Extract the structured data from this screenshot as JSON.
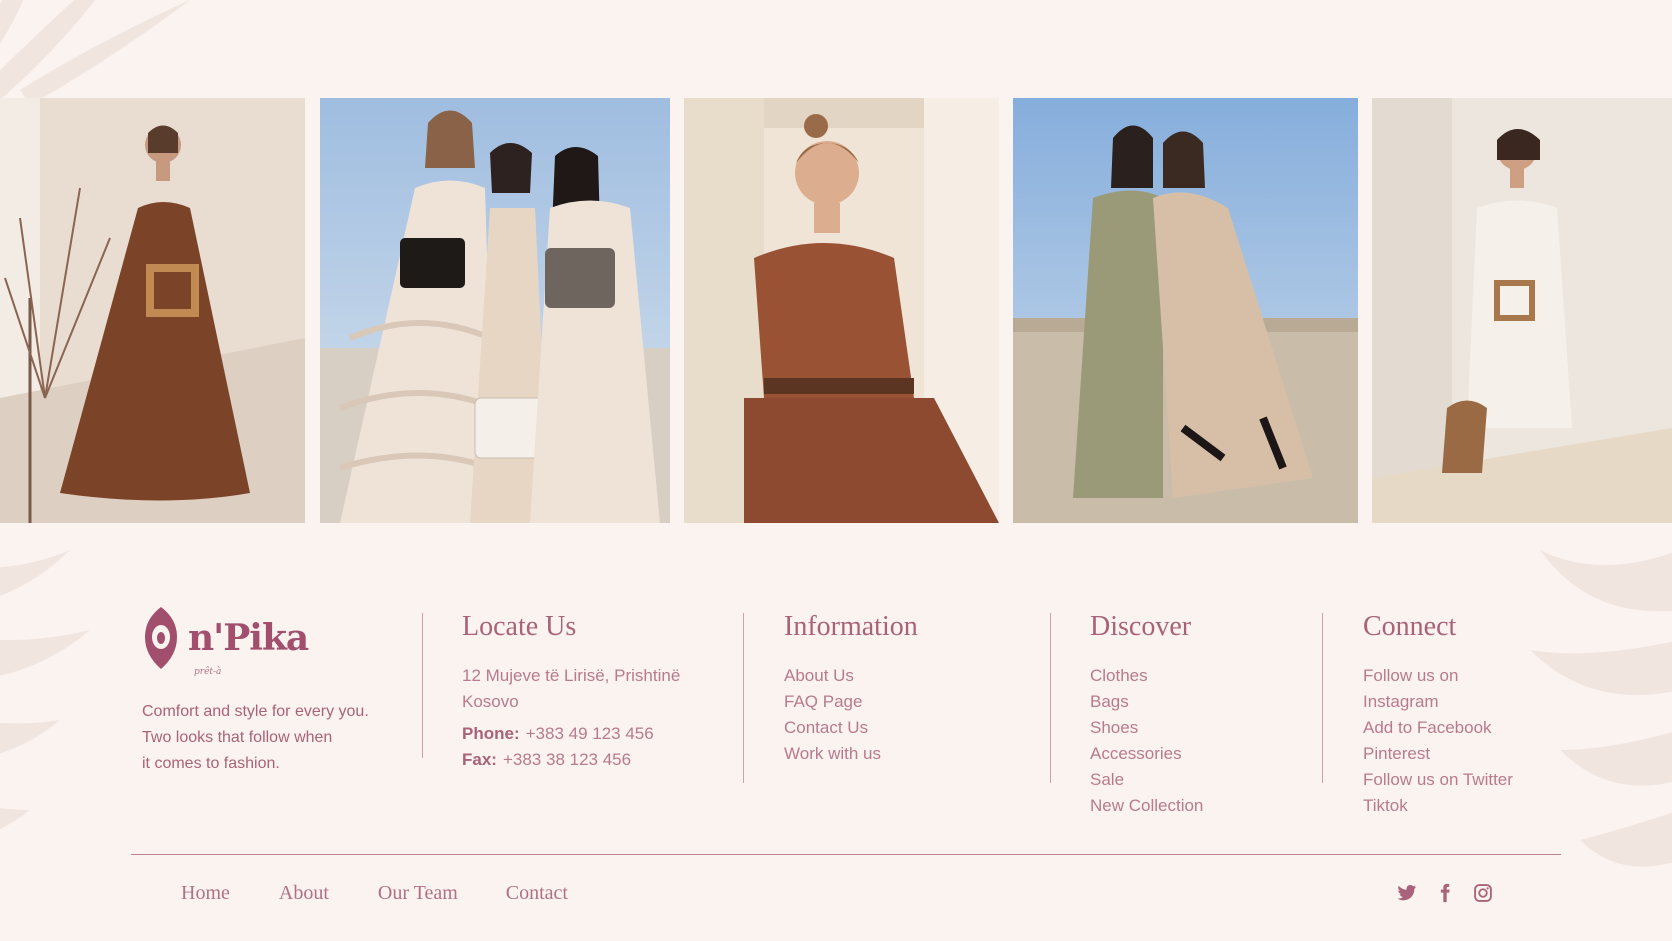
{
  "brand": {
    "name": "n'Pika",
    "tagline": "prêt-à",
    "description": [
      "Comfort and style for every you.",
      "Two looks that follow when",
      "it comes to fashion."
    ]
  },
  "gallery": [
    {
      "alt": "model-brown-dress-stairs"
    },
    {
      "alt": "three-models-ruffled-dresses"
    },
    {
      "alt": "smiling-model-brown-jumpsuit"
    },
    {
      "alt": "two-models-seated-wall"
    },
    {
      "alt": "model-white-romper-basket"
    }
  ],
  "locate": {
    "title": "Locate Us",
    "address": [
      "12 Mujeve të Lirisë, Prishtinë",
      "Kosovo"
    ],
    "phone_label": "Phone:",
    "phone": "+383 49 123 456",
    "fax_label": "Fax:",
    "fax": "+383 38 123 456"
  },
  "information": {
    "title": "Information",
    "links": [
      "About Us",
      "FAQ Page",
      "Contact Us",
      "Work with us"
    ]
  },
  "discover": {
    "title": "Discover",
    "links": [
      "Clothes",
      "Bags",
      "Shoes",
      "Accessories",
      "Sale",
      "New Collection"
    ]
  },
  "connect": {
    "title": "Connect",
    "links": [
      "Follow us on",
      "Instagram",
      "Add to Facebook",
      "Pinterest",
      "Follow us on Twitter",
      "Tiktok"
    ]
  },
  "bottom_nav": [
    "Home",
    "About",
    "Our Team",
    "Contact"
  ],
  "social": [
    "twitter-icon",
    "facebook-icon",
    "instagram-icon"
  ],
  "colors": {
    "accent": "#a8637a",
    "background": "#fbf3ef",
    "logo": "#a24f6e"
  }
}
